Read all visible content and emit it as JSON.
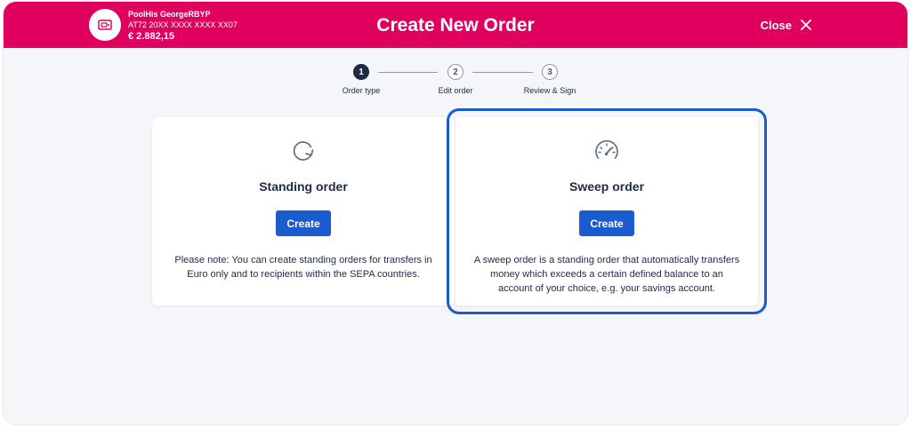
{
  "header": {
    "account_name": "PoolHis GeorgeRBYP",
    "account_iban": "AT72 20XX XXXX XXXX XX07",
    "account_balance": "€ 2.882,15",
    "title": "Create New Order",
    "close_label": "Close",
    "brand_color": "#e0005d"
  },
  "stepper": {
    "steps": [
      {
        "number": "1",
        "label": "Order type",
        "state": "active"
      },
      {
        "number": "2",
        "label": "Edit order",
        "state": "inactive"
      },
      {
        "number": "3",
        "label": "Review & Sign",
        "state": "inactive"
      }
    ]
  },
  "cards": [
    {
      "icon": "refresh-icon",
      "title": "Standing order",
      "button_label": "Create",
      "note": "Please note: You can create standing orders for transfers in Euro only and to recipients within the SEPA countries.",
      "selected": false
    },
    {
      "icon": "gauge-icon",
      "title": "Sweep order",
      "button_label": "Create",
      "note": "A sweep order is a standing order that automatically transfers money which exceeds a certain defined balance to an account of your choice, e.g. your savings account.",
      "selected": true
    }
  ],
  "colors": {
    "primary_button": "#1a5ccf",
    "selection_outline": "#1a5ccf",
    "text": "#1f2a44"
  }
}
